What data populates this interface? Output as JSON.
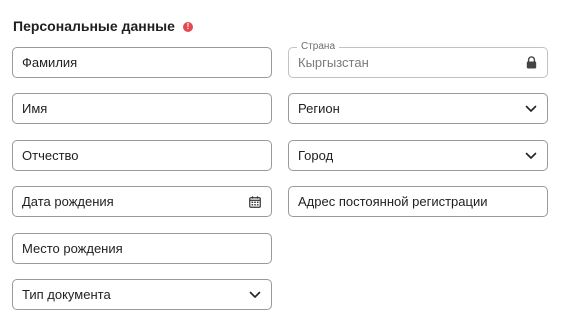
{
  "section": {
    "title": "Персональные данные",
    "warning_icon": "exclamation-circle-icon",
    "warning_color": "#e5484d"
  },
  "left_fields": [
    {
      "label": "Фамилия"
    },
    {
      "label": "Имя"
    },
    {
      "label": "Отчество"
    },
    {
      "label": "Дата рождения",
      "icon": "calendar-icon"
    },
    {
      "label": "Место рождения"
    },
    {
      "label": "Тип документа",
      "icon": "chevron-down-icon"
    }
  ],
  "right_fields": [
    {
      "legend": "Страна",
      "value": "Кыргызстан",
      "icon": "lock-icon",
      "disabled": true
    },
    {
      "label": "Регион",
      "icon": "chevron-down-icon"
    },
    {
      "label": "Город",
      "icon": "chevron-down-icon"
    },
    {
      "label": "Адрес постоянной регистрации"
    }
  ]
}
